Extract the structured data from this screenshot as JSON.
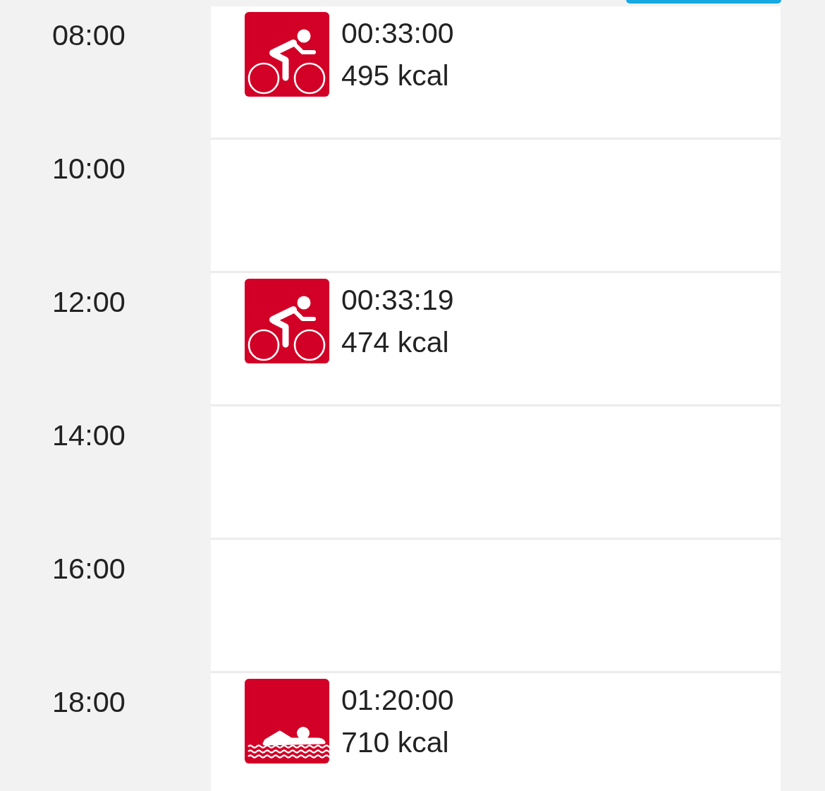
{
  "schedule": [
    {
      "time": "08:00",
      "activity": {
        "kind": "cycling",
        "duration": "00:33:00",
        "energy": "495 kcal"
      }
    },
    {
      "time": "10:00"
    },
    {
      "time": "12:00",
      "activity": {
        "kind": "cycling",
        "duration": "00:33:19",
        "energy": "474 kcal"
      }
    },
    {
      "time": "14:00"
    },
    {
      "time": "16:00"
    },
    {
      "time": "18:00",
      "activity": {
        "kind": "swimming",
        "duration": "01:20:00",
        "energy": "710 kcal"
      }
    }
  ]
}
